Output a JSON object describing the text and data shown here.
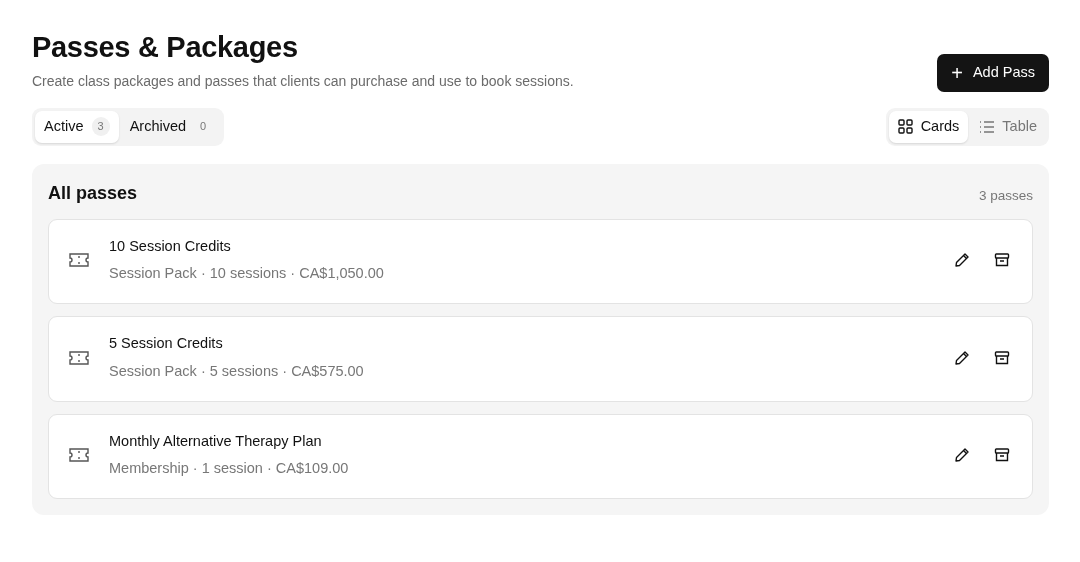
{
  "header": {
    "title": "Passes & Packages",
    "subtitle": "Create class packages and passes that clients can purchase and use to book sessions.",
    "add_button": {
      "icon": "+",
      "label": "Add Pass"
    }
  },
  "status_tabs": [
    {
      "label": "Active",
      "count": "3",
      "selected": true
    },
    {
      "label": "Archived",
      "count": "0",
      "selected": false
    }
  ],
  "view_toggle": [
    {
      "kind": "grid",
      "label": "Cards",
      "selected": true
    },
    {
      "kind": "list",
      "label": "Table",
      "selected": false
    }
  ],
  "panel": {
    "title": "All passes",
    "count": "3 passes",
    "passes": [
      {
        "name": "10 Session Credits",
        "details": "Session Pack · 10 sessions · CA$1,050.00"
      },
      {
        "name": "5 Session Credits",
        "details": "Session Pack · 5 sessions · CA$575.00"
      },
      {
        "name": "Monthly Alternative Therapy Plan",
        "details": "Membership · 1 session · CA$109.00"
      }
    ]
  }
}
